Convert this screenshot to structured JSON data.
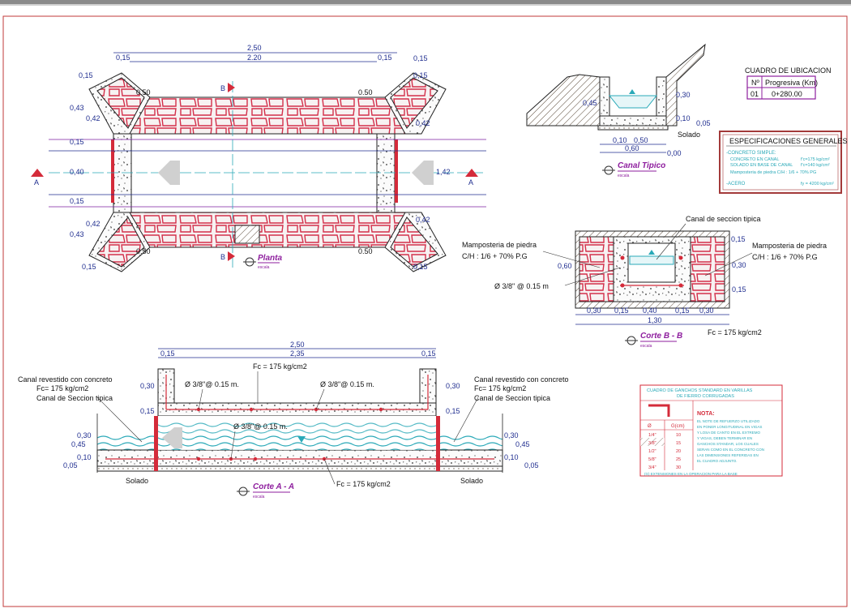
{
  "plan": {
    "dim_total": "2,50",
    "dim_inner": "2.20",
    "dim_side_left": "0,15",
    "dim_side_right": "0,15",
    "dim_wall_l": "0,15",
    "dim_wall_r": "0,15",
    "dim_043_l": "0,43",
    "dim_042_l": "0,42",
    "dim_043_l2": "0,43",
    "dim_042_l2": "0,42",
    "dim_042_r": "0,42",
    "dim_042_r2": "0,42",
    "dim_015_bl": "0,15",
    "dim_015_br": "0,15",
    "dim_015_top_r": "0,15",
    "dim_050_tl": "0.50",
    "dim_050_tr": "0.50",
    "dim_050_bl": "0.50",
    "dim_050_br": "0.50",
    "dim_left_015a": "0,15",
    "dim_left_040": "0,40",
    "dim_left_015b": "0,15",
    "dim_right_142": "1,42",
    "mark_a_left": "A",
    "mark_a_right": "A",
    "mark_b_top": "B",
    "mark_b_bottom": "B",
    "title": "Planta",
    "scale": "escala"
  },
  "typical": {
    "d_045": "0,45",
    "d_030": "0,30",
    "d_010": "0,10",
    "d_005": "0,05",
    "d_010b": "0,10",
    "d_050": "0,50",
    "d_060": "0,60",
    "d_000": "0,00",
    "soil": "Solado",
    "title": "Canal Tipico",
    "scale": "escala"
  },
  "ubicacion": {
    "title": "CUADRO DE UBICACION",
    "col1": "Nº",
    "col2": "Progresiva (Km)",
    "row_no": "01",
    "row_prog": "0+280.00"
  },
  "specs": {
    "title": "ESPECIFICACIONES GENERALES",
    "l1": "-CONCRETO SIMPLE:",
    "l2a": "CONCRETO EN CANAL",
    "l2b": "f'c=175 kg/cm²",
    "l3a": "SOLADO EN BASE DE CANAL",
    "l3b": "f'c=140 kg/cm²",
    "l4a": "Mamposteria de piedra C/H : 1/6 + 70% PG",
    "l5a": "-ACERO",
    "l5b": "fy = 4200 kg/cm²"
  },
  "sectionB": {
    "label_top": "Canal de seccion tipica",
    "left_l1": "Mamposteria de piedra",
    "left_l2": "C/H : 1/6 + 70% P.G",
    "right_l1": "Mamposteria de piedra",
    "right_l2": "C/H : 1/6 + 70% P.G",
    "rebar": "Ø 3/8\" @ 0.15 m",
    "d_060": "0,60",
    "d_015a": "0,15",
    "d_030r": "0,30",
    "d_015r": "0,15",
    "d_030a": "0,30",
    "d_015b": "0,15",
    "d_040": "0,40",
    "d_015c": "0,15",
    "d_030b": "0,30",
    "d_130": "1,30",
    "fc": "Fc = 175 kg/cm2",
    "title": "Corte B - B",
    "scale": "escala"
  },
  "sectionA": {
    "d_250": "2,50",
    "d_015l": "0,15",
    "d_235": "2,35",
    "d_015r": "0,15",
    "fc_top": "Fc = 175 kg/cm2",
    "rebar1": "Ø 3/8\"@ 0.15 m.",
    "rebar2": "Ø 3/8\"@ 0.15 m.",
    "rebar3": "Ø 3/8\"@ 0.15 m.",
    "left_l1": "Canal revestido con concreto",
    "left_l2": "Fc= 175 kg/cm2",
    "left_l3": "Canal de Seccion tipica",
    "right_l1": "Canal revestido con concreto",
    "right_l2": "Fc= 175 kg/cm2",
    "right_l3": "Canal de Seccion tipica",
    "d_030a": "0,30",
    "d_015a": "0,15",
    "d_030b": "0,30",
    "d_015b": "0,15",
    "l_030": "0,30",
    "l_045": "0,45",
    "l_010": "0,10",
    "l_005": "0,05",
    "r_030": "0,30",
    "r_045": "0,45",
    "r_010": "0,10",
    "r_005": "0,05",
    "fc_bottom": "Fc = 175 kg/cm2",
    "soil_l": "Solado",
    "soil_r": "Solado",
    "title": "Corte A - A",
    "scale": "escala"
  },
  "ganchos": {
    "title1": "CUADRO DE GANCHOS STANDARD EN VARILLAS",
    "title2": "DE FIERRO CORRUGADAS",
    "nota": "NOTA:",
    "n1": "EL NOTE DE REFUERZO UTILIZADO",
    "n2": "EN PONER LONGITUDINAL EN VIGAS",
    "n3": "Y LOSA DE CANTO EN EL EXTREMO",
    "n4": "Y VIGAS, DEBEN TERMINAR EN",
    "n5": "GANCHOS STANDAR, LOS CUALES",
    "n6": "SERAN COMO EN EL CONCRETO CON",
    "n7": "LAS DIMENSIONES REFERIDAS EN",
    "n8": "EL CUADRO ADJUNTO.",
    "h1": "Ø",
    "h2": "G(cm)",
    "rows": [
      {
        "d": "1/4\"",
        "g": "10"
      },
      {
        "d": "3/8\"",
        "g": "15"
      },
      {
        "d": "1/2\"",
        "g": "20"
      },
      {
        "d": "5/8\"",
        "g": "25"
      },
      {
        "d": "3/4\"",
        "g": "30"
      }
    ],
    "footer": "(G) EXTENSIONES EN LA OPERACION PARA LA BASE"
  }
}
